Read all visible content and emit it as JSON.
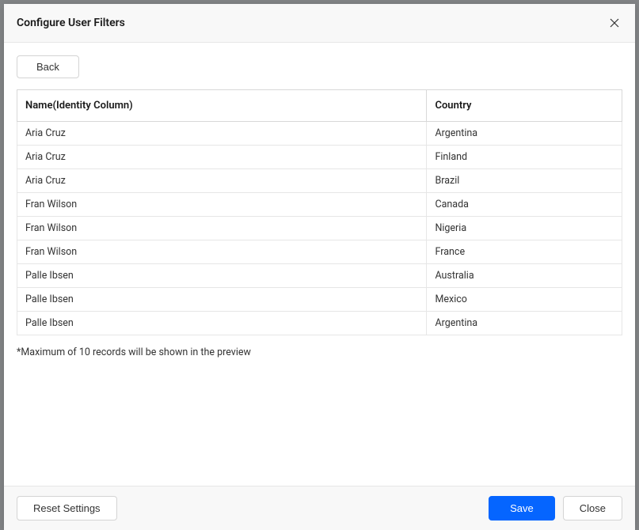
{
  "header": {
    "title": "Configure User Filters"
  },
  "body": {
    "back_label": "Back",
    "columns": {
      "name": "Name(Identity Column)",
      "country": "Country"
    },
    "rows": [
      {
        "name": "Aria Cruz",
        "country": "Argentina"
      },
      {
        "name": "Aria Cruz",
        "country": "Finland"
      },
      {
        "name": "Aria Cruz",
        "country": "Brazil"
      },
      {
        "name": "Fran Wilson",
        "country": "Canada"
      },
      {
        "name": "Fran Wilson",
        "country": "Nigeria"
      },
      {
        "name": "Fran Wilson",
        "country": "France"
      },
      {
        "name": "Palle Ibsen",
        "country": "Australia"
      },
      {
        "name": "Palle Ibsen",
        "country": "Mexico"
      },
      {
        "name": "Palle Ibsen",
        "country": "Argentina"
      }
    ],
    "note": "*Maximum of 10 records will be shown in the preview"
  },
  "footer": {
    "reset_label": "Reset Settings",
    "save_label": "Save",
    "close_label": "Close"
  }
}
